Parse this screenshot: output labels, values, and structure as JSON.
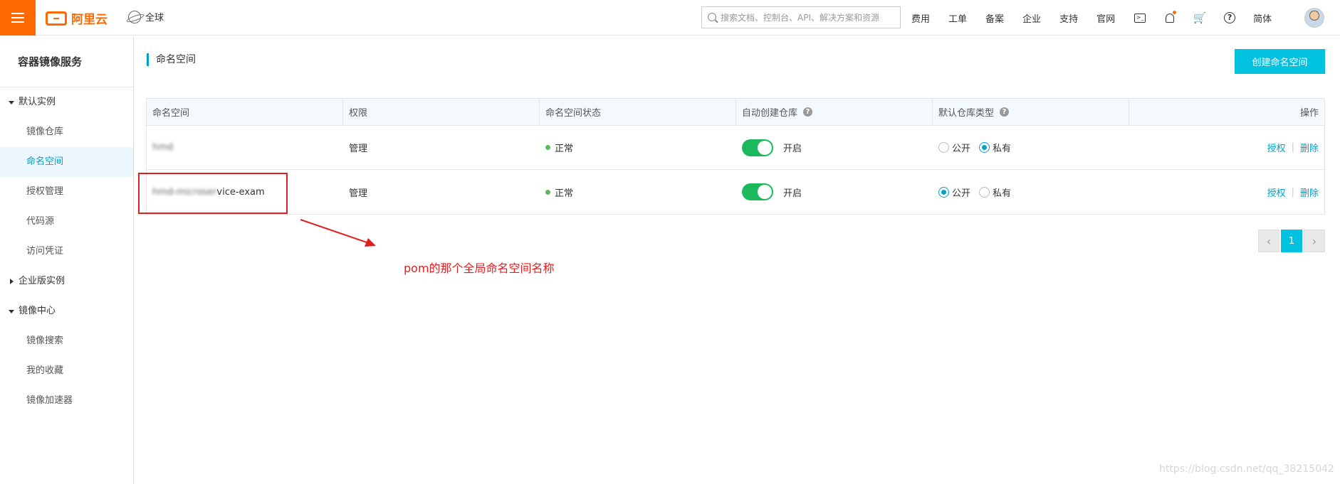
{
  "topbar": {
    "logo_text": "阿里云",
    "region": "全球",
    "search_placeholder": "搜索文档、控制台、API、解决方案和资源",
    "nav": [
      "费用",
      "工单",
      "备案",
      "企业",
      "支持",
      "官网"
    ],
    "lang": "简体",
    "brand_color": "#ff6a00"
  },
  "sidebar": {
    "title": "容器镜像服务",
    "groups": [
      {
        "label": "默认实例",
        "expanded": true,
        "items": [
          "镜像仓库",
          "命名空间",
          "授权管理",
          "代码源",
          "访问凭证"
        ]
      },
      {
        "label": "企业版实例",
        "expanded": false,
        "items": []
      },
      {
        "label": "镜像中心",
        "expanded": true,
        "items": [
          "镜像搜索",
          "我的收藏",
          "镜像加速器"
        ]
      }
    ],
    "active_item": "命名空间"
  },
  "main": {
    "page_title": "命名空间",
    "create_button": "创建命名空间",
    "table": {
      "headers": [
        "命名空间",
        "权限",
        "命名空间状态",
        "自动创建仓库",
        "默认仓库类型",
        "操作"
      ],
      "rows": [
        {
          "namespace_blurred": "hmd",
          "namespace_suffix": "",
          "permission": "管理",
          "status": "正常",
          "auto_create": "开启",
          "auto_create_on": true,
          "public_label": "公开",
          "private_label": "私有",
          "default_type": "private",
          "op_auth": "授权",
          "op_sep": "|",
          "op_delete": "删除"
        },
        {
          "namespace_blurred": "hmd-microser",
          "namespace_suffix": "vice-exam",
          "permission": "管理",
          "status": "正常",
          "auto_create": "开启",
          "auto_create_on": true,
          "public_label": "公开",
          "private_label": "私有",
          "default_type": "public",
          "op_auth": "授权",
          "op_sep": "|",
          "op_delete": "删除"
        }
      ]
    },
    "pagination": {
      "prev": "‹",
      "current": "1",
      "next": "›"
    }
  },
  "annotation": {
    "text": "pom的那个全局命名空间名称",
    "color": "#e02020"
  },
  "watermark": "https://blog.csdn.net/qq_38215042",
  "accent_color": "#00c1de"
}
